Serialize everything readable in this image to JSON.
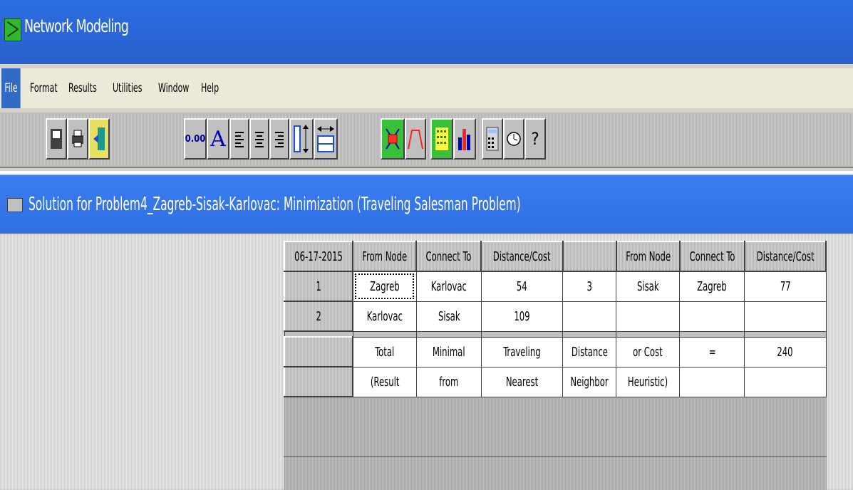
{
  "app": {
    "title": "Network Modeling"
  },
  "menu": {
    "items": [
      "File",
      "Format",
      "Results",
      "Utilities",
      "Window",
      "Help"
    ],
    "active": "File"
  },
  "toolbar": {
    "buttons": [
      {
        "name": "save-icon"
      },
      {
        "name": "print-icon"
      },
      {
        "name": "exit-icon"
      },
      {
        "name": "decimal-format-icon",
        "label": "0.00"
      },
      {
        "name": "font-icon",
        "label": "A"
      },
      {
        "name": "align-left-icon"
      },
      {
        "name": "align-center-icon"
      },
      {
        "name": "align-right-icon"
      },
      {
        "name": "row-height-icon"
      },
      {
        "name": "column-width-icon"
      },
      {
        "name": "graph-network-icon"
      },
      {
        "name": "chart-line-icon"
      },
      {
        "name": "matrix-icon"
      },
      {
        "name": "bar-chart-icon"
      },
      {
        "name": "calculator-icon"
      },
      {
        "name": "clock-icon"
      },
      {
        "name": "help-icon",
        "label": "?"
      }
    ]
  },
  "solution": {
    "title": "Solution for Problem4_Zagreb-Sisak-Karlovac: Minimization (Traveling Salesman Problem)",
    "header": [
      "06-17-2015",
      "From Node",
      "Connect To",
      "Distance/Cost",
      "",
      "From Node",
      "Connect To",
      "Distance/Cost"
    ],
    "rows": [
      [
        "1",
        "Zagreb",
        "Karlovac",
        "54",
        "3",
        "Sisak",
        "Zagreb",
        "77"
      ],
      [
        "2",
        "Karlovac",
        "Sisak",
        "109",
        "",
        "",
        "",
        ""
      ]
    ],
    "summary": [
      [
        "",
        "Total",
        "Minimal",
        "Traveling",
        "Distance",
        "or Cost",
        "=",
        "240"
      ],
      [
        "",
        "(Result",
        "from",
        "Nearest",
        "Neighbor",
        "Heuristic)",
        "",
        ""
      ]
    ]
  }
}
